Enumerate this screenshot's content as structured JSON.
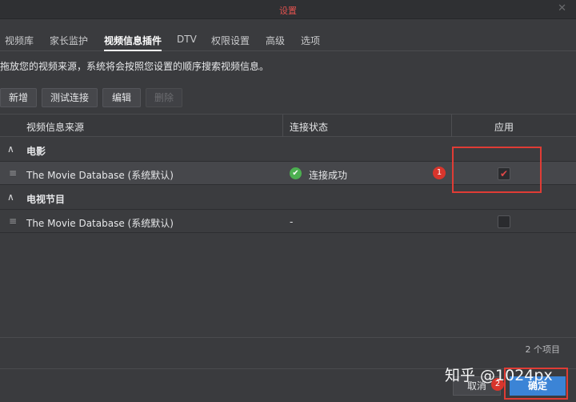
{
  "window": {
    "title": "设置",
    "close_glyph": "✕"
  },
  "tabs": [
    {
      "label": "视频库"
    },
    {
      "label": "家长监护"
    },
    {
      "label": "视频信息插件",
      "active": true
    },
    {
      "label": "DTV"
    },
    {
      "label": "权限设置"
    },
    {
      "label": "高级"
    },
    {
      "label": "选项"
    }
  ],
  "description": "拖放您的视频来源，系统将会按照您设置的顺序搜索视频信息。",
  "toolbar": {
    "add": "新增",
    "test": "测试连接",
    "edit": "编辑",
    "delete": "删除"
  },
  "table": {
    "columns": {
      "source": "视频信息来源",
      "status": "连接状态",
      "apply": "应用"
    },
    "groups": [
      {
        "label": "电影",
        "arrow": "∧",
        "rows": [
          {
            "source": "The Movie Database (系统默认)",
            "status": "连接成功",
            "status_icon": "check-circle-icon",
            "checked": true
          }
        ]
      },
      {
        "label": "电视节目",
        "arrow": "∧",
        "rows": [
          {
            "source": "The Movie Database (系统默认)",
            "status": "-",
            "checked": false
          }
        ]
      }
    ],
    "drag_glyph": "≡",
    "check_glyph": "✔"
  },
  "item_count": "2 个项目",
  "footer": {
    "cancel": "取消",
    "ok": "确定"
  },
  "annotations": {
    "badge1": "1",
    "badge2": "2"
  },
  "watermark": "知乎 @1024px",
  "colors": {
    "accent": "#3b84d6",
    "annotation": "#e03c35",
    "success": "#4caf50"
  }
}
